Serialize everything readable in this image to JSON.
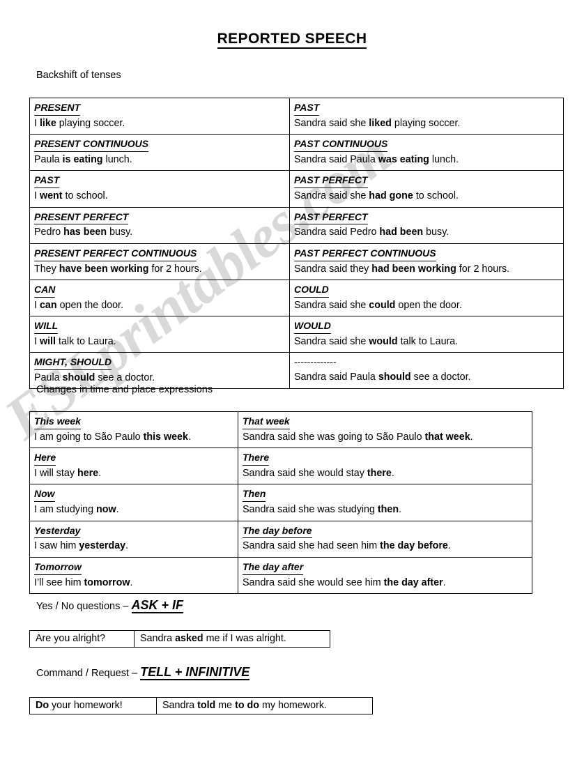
{
  "document": {
    "title": "REPORTED SPEECH",
    "watermark": "ESLprintables.com"
  },
  "sections": {
    "backshift_label": "Backshift of tenses",
    "changes_label": "Changes in time and place expressions",
    "yesno_label_plain": "Yes / No questions – ",
    "yesno_label_emph": "ASK + IF",
    "command_label_plain": "Command / Request – ",
    "command_label_emph": "TELL + INFINITIVE"
  },
  "backshift_table": {
    "rows": [
      {
        "direct_header": "PRESENT",
        "direct_pre": "I ",
        "direct_bold": "like",
        "direct_post": " playing soccer.",
        "reported_header": "PAST",
        "reported_pre": "Sandra said she ",
        "reported_bold": "liked",
        "reported_post": " playing soccer."
      },
      {
        "direct_header": "PRESENT CONTINUOUS",
        "direct_pre": "Paula ",
        "direct_bold": "is eating",
        "direct_post": " lunch.",
        "reported_header": "PAST CONTINUOUS",
        "reported_pre": "Sandra said Paula ",
        "reported_bold": "was eating",
        "reported_post": " lunch."
      },
      {
        "direct_header": "PAST",
        "direct_pre": "I ",
        "direct_bold": "went",
        "direct_post": " to school.",
        "reported_header": "PAST PERFECT",
        "reported_pre": "Sandra said she ",
        "reported_bold": "had gone",
        "reported_post": " to school."
      },
      {
        "direct_header": "PRESENT PERFECT",
        "direct_pre": "Pedro ",
        "direct_bold": "has been",
        "direct_post": " busy.",
        "reported_header": "PAST PERFECT",
        "reported_pre": "Sandra said Pedro ",
        "reported_bold": "had been",
        "reported_post": " busy."
      },
      {
        "direct_header": "PRESENT PERFECT CONTINUOUS",
        "direct_pre": "They ",
        "direct_bold": "have been working",
        "direct_post": " for 2 hours.",
        "reported_header": "PAST PERFECT CONTINUOUS",
        "reported_pre": "Sandra said they ",
        "reported_bold": "had been working",
        "reported_post": " for 2 hours."
      },
      {
        "direct_header": "CAN",
        "direct_pre": "I ",
        "direct_bold": "can",
        "direct_post": " open the door.",
        "reported_header": "COULD",
        "reported_pre": "Sandra said she ",
        "reported_bold": "could",
        "reported_post": " open the door."
      },
      {
        "direct_header": "WILL",
        "direct_pre": "I ",
        "direct_bold": "will",
        "direct_post": " talk to Laura.",
        "reported_header": "WOULD",
        "reported_pre": "Sandra said she ",
        "reported_bold": "would",
        "reported_post": " talk to Laura."
      },
      {
        "direct_header": "MIGHT, SHOULD",
        "direct_pre": "Paula ",
        "direct_bold": "should",
        "direct_post": " see a doctor.",
        "reported_header": "-------------",
        "reported_pre": "Sandra said Paula ",
        "reported_bold": "should",
        "reported_post": " see a doctor."
      }
    ]
  },
  "changes_table": {
    "rows": [
      {
        "direct_header": "This week",
        "direct_pre": "I am going to São Paulo ",
        "direct_bold": "this week",
        "direct_post": ".",
        "reported_header": "That week",
        "reported_pre": "Sandra said she was going to São Paulo ",
        "reported_bold": "that week",
        "reported_post": "."
      },
      {
        "direct_header": "Here",
        "direct_pre": "I will stay ",
        "direct_bold": "here",
        "direct_post": ".",
        "reported_header": "There",
        "reported_pre": "Sandra said she would stay ",
        "reported_bold": "there",
        "reported_post": "."
      },
      {
        "direct_header": "Now",
        "direct_pre": "I am studying ",
        "direct_bold": "now",
        "direct_post": ".",
        "reported_header": "Then",
        "reported_pre": "Sandra said she was studying ",
        "reported_bold": "then",
        "reported_post": "."
      },
      {
        "direct_header": "Yesterday",
        "direct_pre": "I saw him ",
        "direct_bold": "yesterday",
        "direct_post": ".",
        "reported_header": "The day before",
        "reported_pre": "Sandra said she had seen him ",
        "reported_bold": "the day before",
        "reported_post": "."
      },
      {
        "direct_header": "Tomorrow",
        "direct_pre": "I’ll see him ",
        "direct_bold": "tomorrow",
        "direct_post": ".",
        "reported_header": "The day after",
        "reported_pre": "Sandra said she would see him ",
        "reported_bold": "the day after",
        "reported_post": "."
      }
    ]
  },
  "yesno_box": {
    "direct": "Are you alright?",
    "reported_pre": "Sandra ",
    "reported_bold": "asked",
    "reported_post": " me if I was alright."
  },
  "command_box": {
    "direct_bold": "Do",
    "direct_post": " your homework!",
    "reported_pre": "Sandra ",
    "reported_bold1": "told",
    "reported_mid": " me ",
    "reported_bold2": "to do",
    "reported_post": " my homework."
  }
}
